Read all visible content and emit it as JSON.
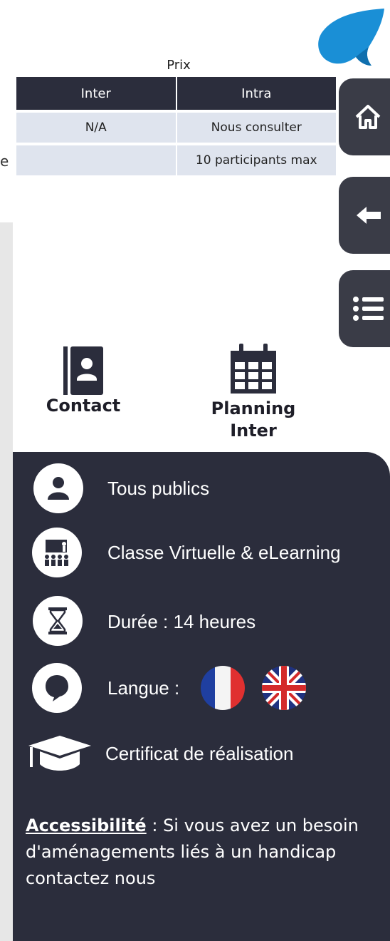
{
  "edge_letter": "e",
  "price": {
    "title": "Prix",
    "headers": [
      "Inter",
      "Intra"
    ],
    "rows": [
      [
        "N/A",
        "Nous consulter"
      ],
      [
        "",
        "10 participants max"
      ]
    ]
  },
  "nav": [
    {
      "icon": "home-icon"
    },
    {
      "icon": "arrow-left-icon"
    },
    {
      "icon": "list-icon"
    }
  ],
  "actions": {
    "contact": {
      "label": "Contact",
      "icon": "contact-book-icon"
    },
    "planning": {
      "label_line1": "Planning",
      "label_line2": "Inter",
      "icon": "calendar-icon"
    }
  },
  "info": {
    "public": "Tous publics",
    "format": "Classe Virtuelle & eLearning",
    "duration": "Durée :  14 heures",
    "language_label": "Langue :",
    "certificate": "Certificat de réalisation",
    "languages": [
      "french-flag-icon",
      "uk-flag-icon"
    ]
  },
  "accessibility": {
    "label": "Accessibilité",
    "text": " : Si vous avez un besoin d'aménagements liés à un handicap contactez nous"
  },
  "colors": {
    "dark": "#2b2d3c",
    "nav": "#3a3c47",
    "table_cell": "#dfe4ee",
    "logo_blue": "#1a8fd6"
  }
}
